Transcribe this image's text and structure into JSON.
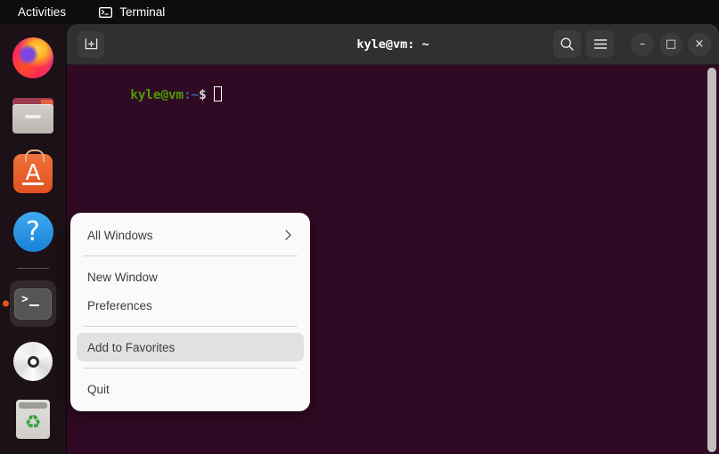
{
  "topbar": {
    "activities_label": "Activities",
    "app_name": "Terminal",
    "app_icon": "terminal-icon"
  },
  "dock": {
    "items": [
      {
        "name": "firefox",
        "label": "Firefox",
        "running": false
      },
      {
        "name": "files",
        "label": "Files",
        "running": false
      },
      {
        "name": "ubuntu-software",
        "label": "Ubuntu Software",
        "running": false
      },
      {
        "name": "help",
        "label": "Help",
        "running": false
      },
      {
        "name": "terminal",
        "label": "Terminal",
        "running": true
      },
      {
        "name": "disc",
        "label": "Disc",
        "running": false
      },
      {
        "name": "trash",
        "label": "Trash",
        "running": false
      }
    ]
  },
  "window": {
    "title": "kyle@vm: ~",
    "titlebar": {
      "new_tab_icon": "new-tab-icon",
      "search_icon": "search-icon",
      "menu_icon": "hamburger-menu-icon",
      "minimize_label": "–",
      "maximize_label": "□",
      "close_label": "×"
    },
    "terminal": {
      "prompt_user": "kyle@vm",
      "prompt_colon": ":",
      "prompt_path": "~",
      "prompt_dollar": "$",
      "command": "",
      "background_color": "#300a24",
      "user_color": "#4e9a06",
      "path_color": "#3465a4"
    }
  },
  "context_menu": {
    "items": [
      {
        "label": "All Windows",
        "submenu": true,
        "selected": false,
        "separator_after": true
      },
      {
        "label": "New Window",
        "submenu": false,
        "selected": false,
        "separator_after": false
      },
      {
        "label": "Preferences",
        "submenu": false,
        "selected": false,
        "separator_after": true
      },
      {
        "label": "Add to Favorites",
        "submenu": false,
        "selected": true,
        "separator_after": true
      },
      {
        "label": "Quit",
        "submenu": false,
        "selected": false,
        "separator_after": false
      }
    ],
    "highlight_color": "#e2e1e0",
    "background_color": "#fafafa"
  }
}
